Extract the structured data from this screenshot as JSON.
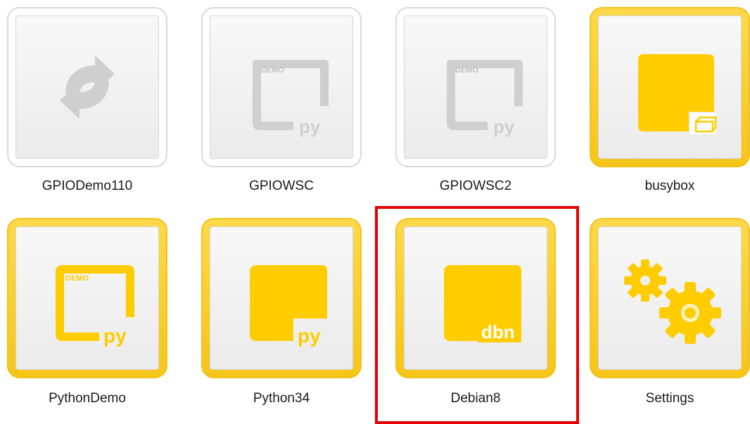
{
  "apps": [
    {
      "label": "GPIODemo110",
      "icon": "sync-arrows-icon",
      "style": "inactive"
    },
    {
      "label": "GPIOWSC",
      "icon": "python-demo-icon",
      "style": "inactive",
      "badge_top": "DEMO",
      "badge_corner": "py"
    },
    {
      "label": "GPIOWSC2",
      "icon": "python-demo-icon",
      "style": "inactive",
      "badge_top": "DEMO",
      "badge_corner": "py"
    },
    {
      "label": "busybox",
      "icon": "busybox-icon",
      "style": "active"
    },
    {
      "label": "PythonDemo",
      "icon": "python-demo-icon",
      "style": "active",
      "badge_top": "DEMO",
      "badge_corner": "py"
    },
    {
      "label": "Python34",
      "icon": "python-icon",
      "style": "active",
      "badge_corner": "py"
    },
    {
      "label": "Debian8",
      "icon": "debian-icon",
      "style": "active",
      "badge_corner": "dbn",
      "selected": true
    },
    {
      "label": "Settings",
      "icon": "gears-icon",
      "style": "active"
    }
  ],
  "colors": {
    "accent": "#ffcc00",
    "inactive_icon": "#c8c8c8",
    "selection": "#e60000"
  }
}
